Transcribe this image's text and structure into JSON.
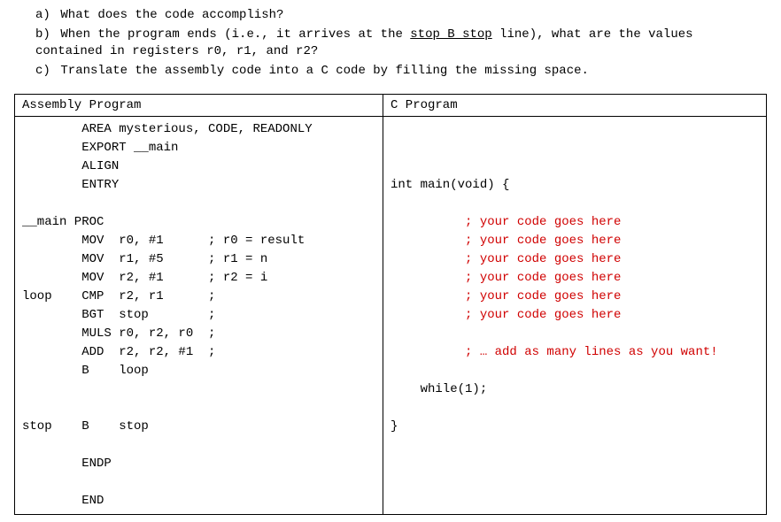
{
  "questions": {
    "a": {
      "label": "a)",
      "text": "What does the code accomplish?"
    },
    "b": {
      "label": "b)",
      "text_before": "When the program ends (i.e., it arrives at the ",
      "underlined": "stop B stop",
      "text_after": " line), what are the values contained in registers r0, r1, and r2?"
    },
    "c": {
      "label": "c)",
      "text": "Translate the assembly code into a C code by filling the missing space."
    }
  },
  "table": {
    "headers": {
      "asm": "Assembly Program",
      "c": "C Program"
    },
    "asm": {
      "prelude": "        AREA mysterious, CODE, READONLY\n        EXPORT __main\n        ALIGN\n        ENTRY",
      "proc_decl": "__main PROC",
      "instructions": "        MOV  r0, #1      ; r0 = result\n        MOV  r1, #5      ; r1 = n\n        MOV  r2, #1      ; r2 = i\nloop    CMP  r2, r1      ;\n        BGT  stop        ;\n        MULS r0, r2, r0  ;\n        ADD  r2, r2, #1  ;\n        B    loop",
      "stop_line": "stop    B    stop",
      "endp": "        ENDP",
      "end": "        END"
    },
    "c": {
      "main_decl": "int main(void) {",
      "placeholder1": "          ; your code goes here",
      "placeholder2": "          ; your code goes here",
      "placeholder3": "          ; your code goes here",
      "placeholder4": "          ; your code goes here",
      "placeholder5": "          ; your code goes here",
      "placeholder6": "          ; your code goes here",
      "add_lines": "          ; … add as many lines as you want!",
      "while_line": "    while(1);",
      "closing_brace": "}"
    }
  }
}
